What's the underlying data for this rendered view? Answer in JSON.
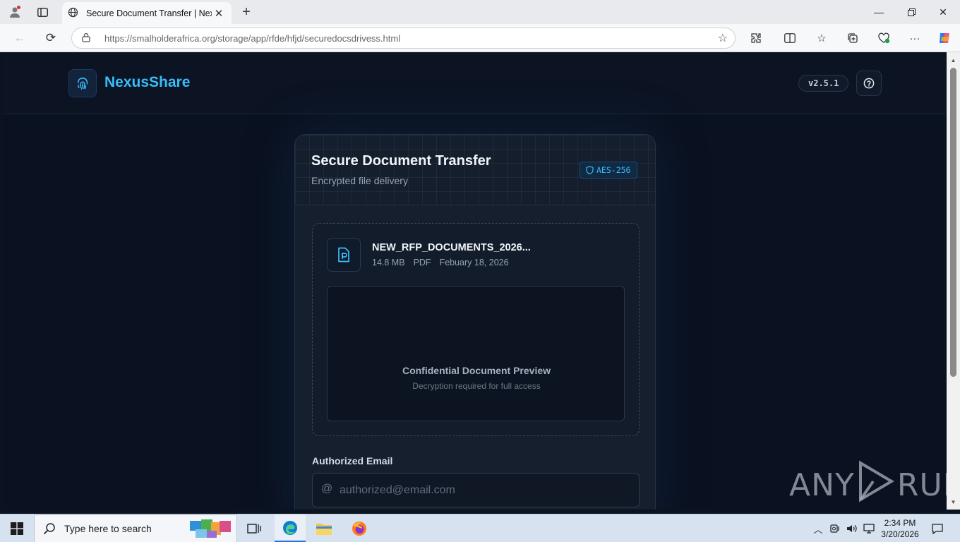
{
  "browser": {
    "tab_title": "Secure Document Transfer | NexusShare",
    "url_host": "https://smalholderafrica.org",
    "url_path": "/storage/app/rfde/hfjd/securedocsdrivess.html"
  },
  "header": {
    "brand": "NexusShare",
    "version": "v2.5.1"
  },
  "card": {
    "title": "Secure Document Transfer",
    "subtitle": "Encrypted file delivery",
    "badge": "AES-256"
  },
  "file": {
    "name": "NEW_RFP_DOCUMENTS_2026...",
    "size": "14.8 MB",
    "type": "PDF",
    "date": "Febuary 18, 2026"
  },
  "preview": {
    "title": "Confidential Document Preview",
    "subtitle": "Decryption required for full access"
  },
  "email": {
    "label": "Authorized Email",
    "at_symbol": "@",
    "placeholder": "authorized@email.com",
    "value": ""
  },
  "watermark": {
    "left": "ANY",
    "right": "RUN"
  },
  "taskbar": {
    "search_placeholder": "Type here to search",
    "time": "2:34 PM",
    "date": "3/20/2026"
  },
  "colors": {
    "accent": "#38bdf8",
    "page_bg": "#0a1120",
    "card_bg": "#161f2e"
  },
  "icons": {
    "logo": "fingerprint-icon",
    "help": "help-circle-icon",
    "badge": "shield-icon",
    "file": "file-document-icon"
  }
}
